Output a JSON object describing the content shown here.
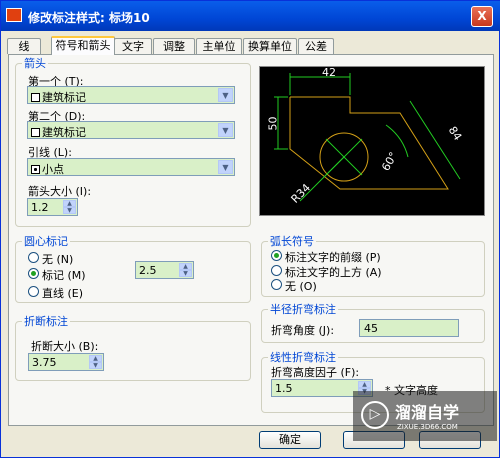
{
  "window": {
    "title": "修改标注样式: 标场10",
    "close": "X"
  },
  "tabs": [
    "线",
    "符号和箭头",
    "文字",
    "调整",
    "主单位",
    "换算单位",
    "公差"
  ],
  "arrows": {
    "legend": "箭头",
    "first_label": "第一个 (T):",
    "first_value": "建筑标记",
    "second_label": "第二个 (D):",
    "second_value": "建筑标记",
    "leader_label": "引线 (L):",
    "leader_value": "小点",
    "size_label": "箭头大小 (I):",
    "size_value": "1.2"
  },
  "center_mark": {
    "legend": "圆心标记",
    "options": [
      "无 (N)",
      "标记 (M)",
      "直线 (E)"
    ],
    "selected": 1,
    "value": "2.5"
  },
  "break": {
    "legend": "折断标注",
    "size_label": "折断大小 (B):",
    "size_value": "3.75"
  },
  "arc_length": {
    "legend": "弧长符号",
    "options": [
      "标注文字的前缀 (P)",
      "标注文字的上方 (A)",
      "无 (O)"
    ],
    "selected": 0
  },
  "radius_jog": {
    "legend": "半径折弯标注",
    "angle_label": "折弯角度 (J):",
    "angle_value": "45"
  },
  "linear_jog": {
    "legend": "线性折弯标注",
    "factor_label": "折弯高度因子 (F):",
    "factor_value": "1.5",
    "unit": "* 文字高度"
  },
  "preview": {
    "dim_top": "42",
    "dim_left": "50",
    "dim_right": "84",
    "angle": "60°",
    "radius": "R34"
  },
  "buttons": {
    "ok": "确定"
  },
  "watermark": {
    "brand": "溜溜自学",
    "url": "ZIXUE.3D66.COM"
  },
  "colors": {
    "title": "#0046D5",
    "geometry": "#D4A017",
    "dims": "#22CC22"
  }
}
